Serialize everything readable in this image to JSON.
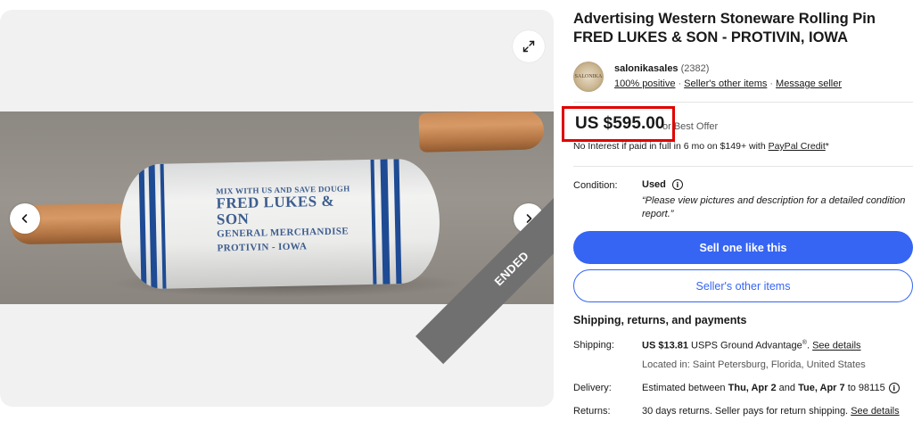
{
  "listing": {
    "title": "Advertising Western Stoneware Rolling Pin FRED LUKES & SON - PROTIVIN, IOWA",
    "status_ribbon": "ENDED"
  },
  "photo": {
    "pin_text": {
      "line1": "MIX WITH US AND SAVE DOUGH",
      "line2": "FRED LUKES & SON",
      "line3": "GENERAL MERCHANDISE",
      "line4": "PROTIVIN    -    IOWA"
    }
  },
  "icons": {
    "expand": "expand-icon",
    "prev": "chevron-left-icon",
    "next": "chevron-right-icon",
    "info": "info-icon"
  },
  "seller": {
    "name": "salonikasales",
    "feedback_count": "(2382)",
    "avatar_text": "SALONIKA",
    "links": [
      "100% positive",
      "Seller's other items",
      "Message seller"
    ]
  },
  "price": {
    "amount": "US $595.00",
    "offer_text": "or Best Offer",
    "paypal_prefix": "No Interest if paid in full in 6 mo on $149+ with ",
    "paypal_link": "PayPal Credit",
    "paypal_suffix": "*"
  },
  "condition": {
    "label": "Condition:",
    "value": "Used",
    "description": "“Please view pictures and description for a detailed condition report.”"
  },
  "buttons": {
    "primary": "Sell one like this",
    "secondary": "Seller's other items"
  },
  "shipping_section": {
    "heading": "Shipping, returns, and payments",
    "shipping_label": "Shipping:",
    "shipping_price": "US $13.81",
    "shipping_service": " USPS Ground Advantage",
    "shipping_reg": "®",
    "shipping_sep": ". ",
    "shipping_link": "See details",
    "location": "Located in: Saint Petersburg, Florida, United States",
    "delivery_label": "Delivery:",
    "delivery_prefix": "Estimated between ",
    "delivery_start": "Thu, Apr 2",
    "delivery_and": " and ",
    "delivery_end": "Tue, Apr 7",
    "delivery_suffix": " to 98115",
    "returns_label": "Returns:",
    "returns_text": "30 days returns. Seller pays for return shipping. ",
    "returns_link": "See details"
  },
  "colors": {
    "primary_blue": "#3665f3",
    "highlight_red": "#e00000",
    "ribbon_gray": "#707070",
    "pin_stripe": "#1e4b93"
  }
}
